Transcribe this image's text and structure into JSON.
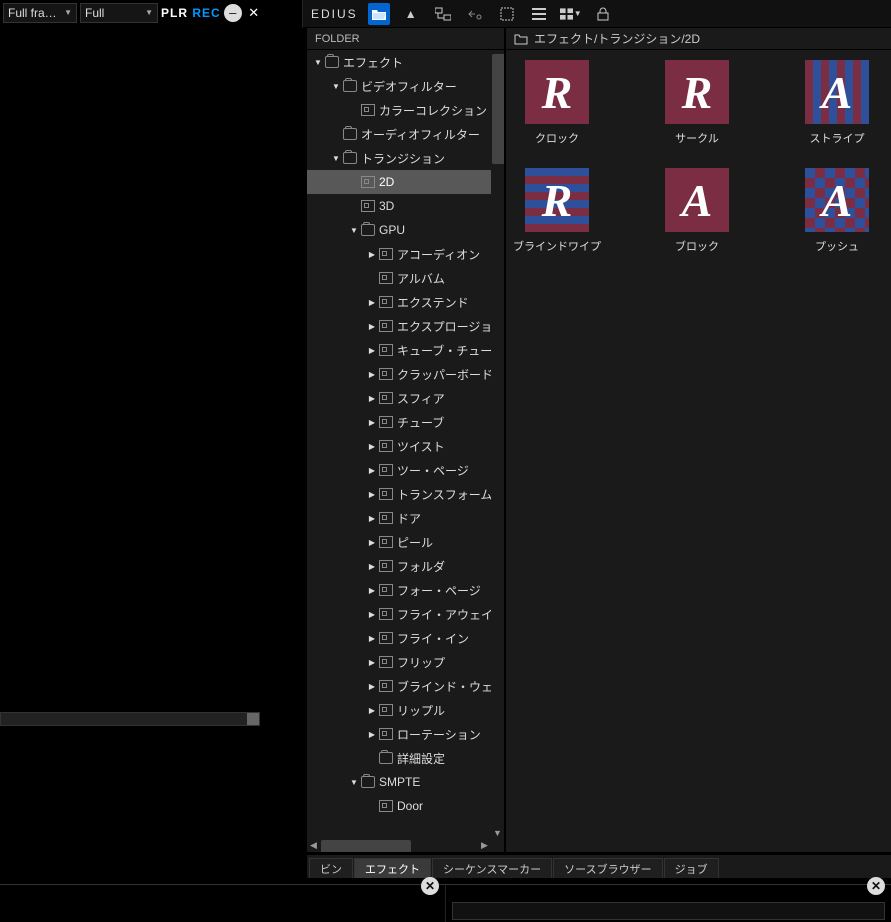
{
  "topLeft": {
    "dd1": "Full fra…",
    "dd2": "Full",
    "plrP": "PLR",
    "plrR": "REC"
  },
  "brand": "EDIUS",
  "folderHeader": "FOLDER",
  "breadcrumb": "エフェクト/トランジション/2D",
  "tree": [
    {
      "indent": 0,
      "disc": "▼",
      "icon": "folder",
      "label": "エフェクト"
    },
    {
      "indent": 1,
      "disc": "▼",
      "icon": "folder",
      "label": "ビデオフィルター"
    },
    {
      "indent": 2,
      "disc": "",
      "icon": "preset",
      "label": "カラーコレクション"
    },
    {
      "indent": 1,
      "disc": "",
      "icon": "folder",
      "label": "オーディオフィルター"
    },
    {
      "indent": 1,
      "disc": "▼",
      "icon": "folder",
      "label": "トランジション"
    },
    {
      "indent": 2,
      "disc": "",
      "icon": "preset",
      "label": "2D",
      "selected": true
    },
    {
      "indent": 2,
      "disc": "",
      "icon": "preset",
      "label": "3D"
    },
    {
      "indent": 2,
      "disc": "▼",
      "icon": "folder",
      "label": "GPU"
    },
    {
      "indent": 3,
      "disc": "▶",
      "icon": "preset",
      "label": "アコーディオン"
    },
    {
      "indent": 3,
      "disc": "",
      "icon": "preset",
      "label": "アルバム"
    },
    {
      "indent": 3,
      "disc": "▶",
      "icon": "preset",
      "label": "エクステンド"
    },
    {
      "indent": 3,
      "disc": "▶",
      "icon": "preset",
      "label": "エクスプロージョン"
    },
    {
      "indent": 3,
      "disc": "▶",
      "icon": "preset",
      "label": "キューブ・チューブ"
    },
    {
      "indent": 3,
      "disc": "▶",
      "icon": "preset",
      "label": "クラッパーボード"
    },
    {
      "indent": 3,
      "disc": "▶",
      "icon": "preset",
      "label": "スフィア"
    },
    {
      "indent": 3,
      "disc": "▶",
      "icon": "preset",
      "label": "チューブ"
    },
    {
      "indent": 3,
      "disc": "▶",
      "icon": "preset",
      "label": "ツイスト"
    },
    {
      "indent": 3,
      "disc": "▶",
      "icon": "preset",
      "label": "ツー・ページ"
    },
    {
      "indent": 3,
      "disc": "▶",
      "icon": "preset",
      "label": "トランスフォーム"
    },
    {
      "indent": 3,
      "disc": "▶",
      "icon": "preset",
      "label": "ドア"
    },
    {
      "indent": 3,
      "disc": "▶",
      "icon": "preset",
      "label": "ピール"
    },
    {
      "indent": 3,
      "disc": "▶",
      "icon": "preset",
      "label": "フォルダ"
    },
    {
      "indent": 3,
      "disc": "▶",
      "icon": "preset",
      "label": "フォー・ページ"
    },
    {
      "indent": 3,
      "disc": "▶",
      "icon": "preset",
      "label": "フライ・アウェイ"
    },
    {
      "indent": 3,
      "disc": "▶",
      "icon": "preset",
      "label": "フライ・イン"
    },
    {
      "indent": 3,
      "disc": "▶",
      "icon": "preset",
      "label": "フリップ"
    },
    {
      "indent": 3,
      "disc": "▶",
      "icon": "preset",
      "label": "ブラインド・ウェーブ"
    },
    {
      "indent": 3,
      "disc": "▶",
      "icon": "preset",
      "label": "リップル"
    },
    {
      "indent": 3,
      "disc": "▶",
      "icon": "preset",
      "label": "ローテーション"
    },
    {
      "indent": 3,
      "disc": "",
      "icon": "folder",
      "label": "詳細設定"
    },
    {
      "indent": 2,
      "disc": "▼",
      "icon": "folder",
      "label": "SMPTE"
    },
    {
      "indent": 3,
      "disc": "",
      "icon": "preset",
      "label": "Door"
    }
  ],
  "effects": [
    {
      "label": "クロック",
      "style": "maroon",
      "glyph": "R"
    },
    {
      "label": "サークル",
      "style": "maroon",
      "glyph": "R"
    },
    {
      "label": "ストライプ",
      "style": "stripes-v",
      "glyph": "A"
    },
    {
      "label": "ブラインドワイプ",
      "style": "stripes-h",
      "glyph": "R"
    },
    {
      "label": "ブロック",
      "style": "maroon",
      "glyph": "A"
    },
    {
      "label": "プッシュ",
      "style": "checker",
      "glyph": "A"
    }
  ],
  "tabs": [
    {
      "label": "ビン"
    },
    {
      "label": "エフェクト",
      "active": true
    },
    {
      "label": "シーケンスマーカー"
    },
    {
      "label": "ソースブラウザー"
    },
    {
      "label": "ジョブ"
    }
  ]
}
